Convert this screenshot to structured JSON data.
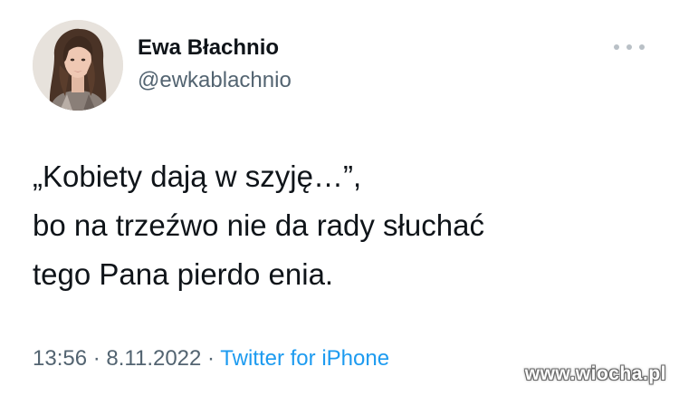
{
  "author": {
    "display_name": "Ewa Błachnio",
    "handle": "@ewkablachnio"
  },
  "tweet": {
    "lines": [
      "„Kobiety dają w szyję…”,",
      "bo na trzeźwo nie da rady słuchać",
      "tego Pana pierdo enia."
    ]
  },
  "meta": {
    "time": "13:56",
    "separator1": " · ",
    "date": "8.11.2022",
    "separator2": " · ",
    "source": "Twitter for iPhone"
  },
  "watermark": "www.wiocha.pl",
  "icons": {
    "more": "more-horizontal-icon"
  },
  "colors": {
    "text": "#0f1419",
    "secondary": "#536471",
    "link": "#1d9bf0"
  }
}
